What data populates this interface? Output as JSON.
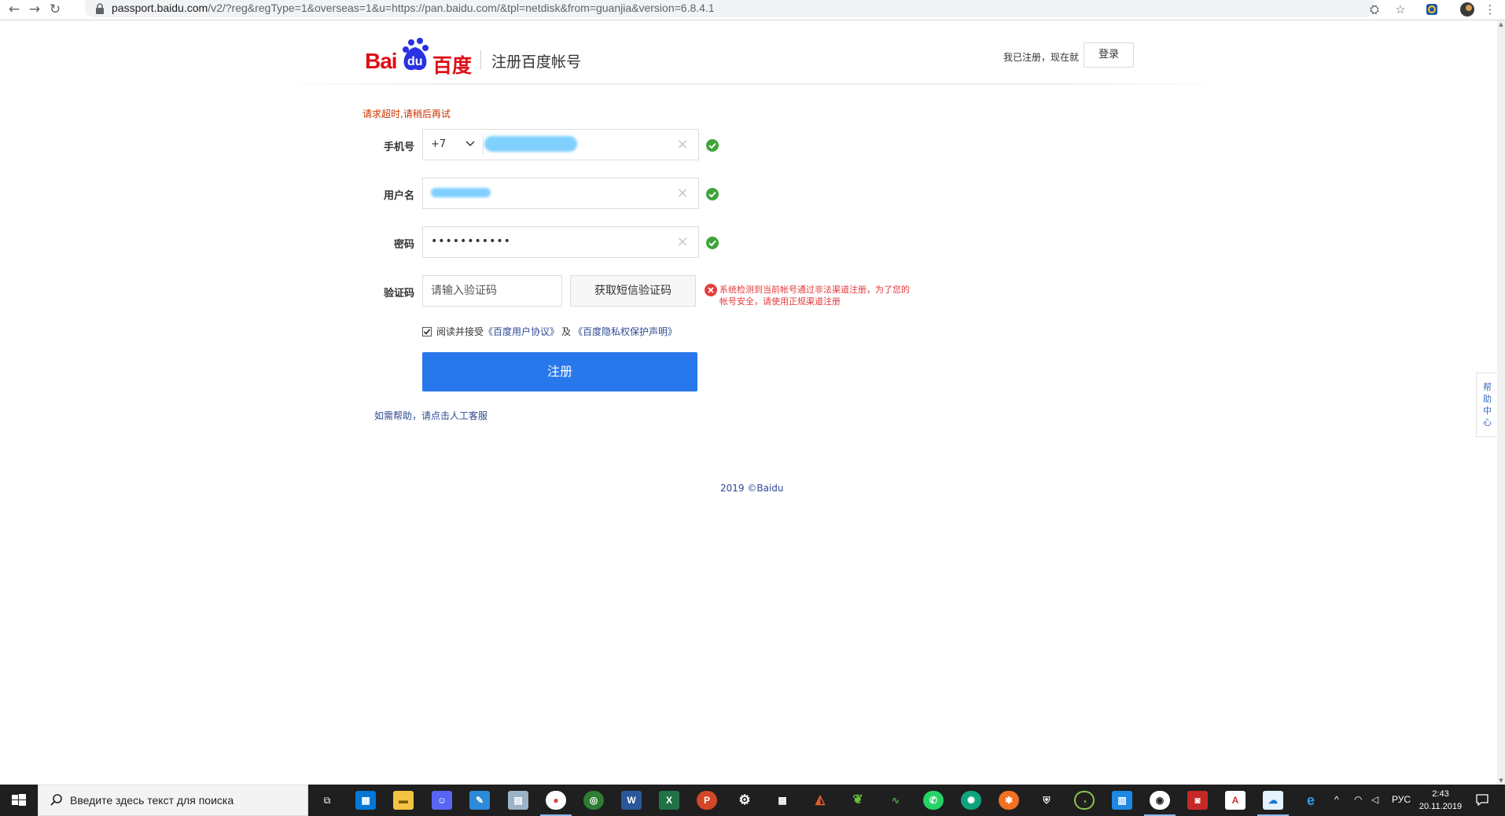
{
  "browser": {
    "url_host": "passport.baidu.com",
    "url_path": "/v2/?reg&regType=1&overseas=1&u=https://pan.baidu.com/&tpl=netdisk&from=guanjia&version=6.8.4.1"
  },
  "header": {
    "logo_text_bai": "Bai",
    "logo_text_du": "du",
    "logo_text_cn": "百度",
    "title": "注册百度帐号",
    "already_registered": "我已注册，现在就",
    "login_button": "登录"
  },
  "form": {
    "timeout_message": "请求超时,请稍后再试",
    "phone_label": "手机号",
    "phone_prefix": "+7",
    "username_label": "用户名",
    "password_label": "密码",
    "password_value": "•••••••••••",
    "code_label": "验证码",
    "code_placeholder": "请输入验证码",
    "sms_button": "获取短信验证码",
    "code_error": "系统检测到当前帐号通过非法渠道注册，为了您的帐号安全，请使用正规渠道注册",
    "agree_text": "阅读并接受",
    "agreement_link": "《百度用户协议》",
    "and_text": "及",
    "privacy_link": "《百度隐私权保护声明》",
    "submit_button": "注册",
    "help_link": "如需帮助，请点击人工客服"
  },
  "footer": {
    "copyright": "2019 ©Baidu"
  },
  "help_tab": [
    "帮",
    "助",
    "中",
    "心"
  ],
  "taskbar": {
    "search_placeholder": "Введите здесь текст для поиска",
    "language": "РУС",
    "time": "2:43",
    "date": "20.11.2019"
  },
  "colors": {
    "brand_red": "#de0f17",
    "brand_blue": "#2932e1",
    "submit_blue": "#2878ec",
    "success_green": "#3fa53b",
    "error_red": "#e4393c"
  }
}
